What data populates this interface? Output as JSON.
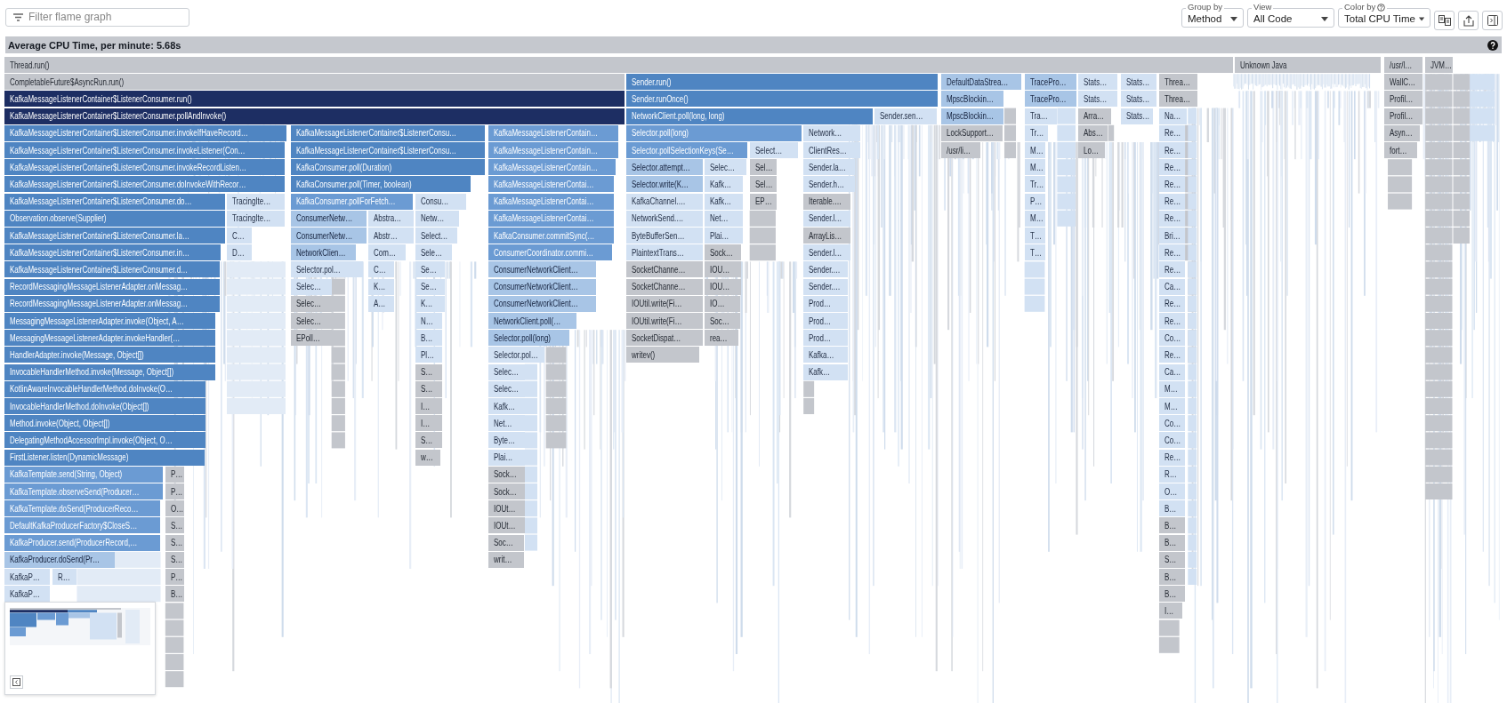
{
  "toolbar": {
    "filter": {
      "placeholder": "Filter flame graph"
    },
    "selects": [
      {
        "label": "Group by",
        "value": "Method",
        "help": false
      },
      {
        "label": "View",
        "value": "All Code",
        "help": false
      },
      {
        "label": "Color by",
        "value": "Total CPU Time",
        "help": true
      }
    ]
  },
  "summary": {
    "title": "Average CPU Time, per minute: 5.68s"
  },
  "flame_graph": {
    "levels": [
      [
        {
          "label": "Thread.run()",
          "kind": "gray"
        },
        {
          "label": "Unknown Java",
          "kind": "gray"
        },
        {
          "label": "/usr/l…",
          "kind": "gray"
        },
        {
          "label": "JVM…",
          "kind": "gray"
        }
      ],
      [
        {
          "label": "CompletableFuture$AsyncRun.run()",
          "kind": "gray"
        },
        {
          "label": "Sender.run()",
          "kind": "mid"
        },
        {
          "label": "DefaultDataStrea…",
          "kind": "light"
        },
        {
          "label": "TracePro…",
          "kind": "light"
        },
        {
          "label": "Stats…",
          "kind": "faint"
        },
        {
          "label": "Stats…",
          "kind": "faint"
        },
        {
          "label": "Threa…",
          "kind": "gray"
        },
        {
          "label": "WallC…",
          "kind": "gray"
        }
      ],
      [
        {
          "label": "KafkaMessageListenerContainer$ListenerConsumer.run()",
          "kind": "dark"
        },
        {
          "label": "Sender.runOnce()",
          "kind": "mid"
        },
        {
          "label": "MpscBlockin…",
          "kind": "light"
        },
        {
          "label": "TracePro…",
          "kind": "light"
        },
        {
          "label": "Stats…",
          "kind": "faint"
        },
        {
          "label": "Stats…",
          "kind": "faint"
        },
        {
          "label": "Threa…",
          "kind": "gray"
        },
        {
          "label": "Profil…",
          "kind": "gray"
        }
      ],
      [
        {
          "label": "KafkaMessageListenerContainer$ListenerConsumer.pollAndInvoke()",
          "kind": "dark"
        },
        {
          "label": "NetworkClient.poll(long, long)",
          "kind": "mid"
        },
        {
          "label": "Sender.sen…",
          "kind": "faint"
        },
        {
          "label": "MpscBlockin…",
          "kind": "light"
        },
        {
          "label": "Tra…",
          "kind": "faint"
        },
        {
          "label": "Arra…",
          "kind": "gray"
        },
        {
          "label": "Stats…",
          "kind": "faint"
        },
        {
          "label": "Na…",
          "kind": "faint"
        },
        {
          "label": "Profil…",
          "kind": "gray"
        }
      ],
      [
        {
          "label": "KafkaMessageListenerContainer$ListenerConsumer.invokeIfHaveRecord…",
          "kind": "mid"
        },
        {
          "label": "KafkaMessageListenerContainer$ListenerConsu…",
          "kind": "mid"
        },
        {
          "label": "KafkaMessageListenerContain…",
          "kind": "soft"
        },
        {
          "label": "Selector.poll(long)",
          "kind": "soft"
        },
        {
          "label": "Network…",
          "kind": "faint"
        },
        {
          "label": "LockSupport…",
          "kind": "gray"
        },
        {
          "label": "Tr…",
          "kind": "faint"
        },
        {
          "label": "Abs…",
          "kind": "gray"
        },
        {
          "label": "Re…",
          "kind": "faint"
        },
        {
          "label": "Asyn…",
          "kind": "gray"
        }
      ],
      [
        {
          "label": "KafkaMessageListenerContainer$ListenerConsumer.invokeListener(Con…",
          "kind": "mid"
        },
        {
          "label": "KafkaMessageListenerContainer$ListenerConsu…",
          "kind": "mid"
        },
        {
          "label": "KafkaMessageListenerContain…",
          "kind": "soft"
        },
        {
          "label": "Selector.pollSelectionKeys(Se…",
          "kind": "soft"
        },
        {
          "label": "Select…",
          "kind": "faint"
        },
        {
          "label": "ClientRes…",
          "kind": "faint"
        },
        {
          "label": "/usr/li…",
          "kind": "gray"
        },
        {
          "label": "M…",
          "kind": "faint"
        },
        {
          "label": "Lo…",
          "kind": "gray"
        },
        {
          "label": "Re…",
          "kind": "faint"
        },
        {
          "label": "fort…",
          "kind": "gray"
        }
      ],
      [
        {
          "label": "KafkaMessageListenerContainer$ListenerConsumer.invokeRecordListen…",
          "kind": "mid"
        },
        {
          "label": "KafkaConsumer.poll(Duration)",
          "kind": "mid"
        },
        {
          "label": "KafkaMessageListenerContain…",
          "kind": "soft"
        },
        {
          "label": "Selector.attempt…",
          "kind": "light"
        },
        {
          "label": "Selec…",
          "kind": "faint"
        },
        {
          "label": "Sel…",
          "kind": "gray"
        },
        {
          "label": "Sender.la…",
          "kind": "faint"
        },
        {
          "label": "M…",
          "kind": "faint"
        },
        {
          "label": "Re…",
          "kind": "faint"
        }
      ],
      [
        {
          "label": "KafkaMessageListenerContainer$ListenerConsumer.doInvokeWithRecor…",
          "kind": "mid"
        },
        {
          "label": "KafkaConsumer.poll(Timer, boolean)",
          "kind": "mid"
        },
        {
          "label": "KafkaMessageListenerContai…",
          "kind": "soft"
        },
        {
          "label": "Selector.write(K…",
          "kind": "light"
        },
        {
          "label": "Kafk…",
          "kind": "faint"
        },
        {
          "label": "Sel…",
          "kind": "gray"
        },
        {
          "label": "Sender.h…",
          "kind": "faint"
        },
        {
          "label": "Tr…",
          "kind": "faint"
        },
        {
          "label": "Re…",
          "kind": "faint"
        }
      ],
      [
        {
          "label": "KafkaMessageListenerContainer$ListenerConsumer.do…",
          "kind": "mid"
        },
        {
          "label": "TracingIte…",
          "kind": "faint"
        },
        {
          "label": "KafkaConsumer.pollForFetch…",
          "kind": "soft"
        },
        {
          "label": "Consu…",
          "kind": "faint"
        },
        {
          "label": "KafkaMessageListenerContai…",
          "kind": "soft"
        },
        {
          "label": "KafkaChannel.…",
          "kind": "faint"
        },
        {
          "label": "Kafk…",
          "kind": "faint"
        },
        {
          "label": "EP…",
          "kind": "gray"
        },
        {
          "label": "Iterable.…",
          "kind": "gray"
        },
        {
          "label": "P…",
          "kind": "faint"
        },
        {
          "label": "Re…",
          "kind": "faint"
        }
      ],
      [
        {
          "label": "Observation.observe(Supplier)",
          "kind": "mid"
        },
        {
          "label": "TracingIte…",
          "kind": "faint"
        },
        {
          "label": "ConsumerNetw…",
          "kind": "light"
        },
        {
          "label": "Abstra…",
          "kind": "faint"
        },
        {
          "label": "Netw…",
          "kind": "faint"
        },
        {
          "label": "KafkaMessageListenerContai…",
          "kind": "soft"
        },
        {
          "label": "NetworkSend.…",
          "kind": "faint"
        },
        {
          "label": "Net…",
          "kind": "faint"
        },
        {
          "label": "Sender.l…",
          "kind": "faint"
        },
        {
          "label": "M…",
          "kind": "faint"
        },
        {
          "label": "Re…",
          "kind": "faint"
        }
      ],
      [
        {
          "label": "KafkaMessageListenerContainer$ListenerConsumer.la…",
          "kind": "mid"
        },
        {
          "label": "C…",
          "kind": "faint"
        },
        {
          "label": "ConsumerNetw…",
          "kind": "light"
        },
        {
          "label": "Abstr…",
          "kind": "faint"
        },
        {
          "label": "Select…",
          "kind": "faint"
        },
        {
          "label": "KafkaConsumer.commitSync(…",
          "kind": "soft"
        },
        {
          "label": "ByteBufferSen…",
          "kind": "faint"
        },
        {
          "label": "Plai…",
          "kind": "faint"
        },
        {
          "label": "ArrayLis…",
          "kind": "gray"
        },
        {
          "label": "T…",
          "kind": "faint"
        },
        {
          "label": "Bri…",
          "kind": "faint"
        }
      ],
      [
        {
          "label": "KafkaMessageListenerContainer$ListenerConsumer.in…",
          "kind": "mid"
        },
        {
          "label": "D…",
          "kind": "faint"
        },
        {
          "label": "NetworkClien…",
          "kind": "light"
        },
        {
          "label": "Com…",
          "kind": "faint"
        },
        {
          "label": "Sele…",
          "kind": "faint"
        },
        {
          "label": "ConsumerCoordinator.commi…",
          "kind": "soft"
        },
        {
          "label": "PlaintextTrans…",
          "kind": "faint"
        },
        {
          "label": "Sock…",
          "kind": "gray"
        },
        {
          "label": "Sender.l…",
          "kind": "faint"
        },
        {
          "label": "T…",
          "kind": "faint"
        },
        {
          "label": "Re…",
          "kind": "faint"
        }
      ],
      [
        {
          "label": "KafkaMessageListenerContainer$ListenerConsumer.d…",
          "kind": "mid"
        },
        {
          "label": "Selector.pol…",
          "kind": "faint"
        },
        {
          "label": "C…",
          "kind": "faint"
        },
        {
          "label": "Se…",
          "kind": "faint"
        },
        {
          "label": "ConsumerNetworkClient…",
          "kind": "light"
        },
        {
          "label": "SocketChanne…",
          "kind": "gray"
        },
        {
          "label": "IOU…",
          "kind": "gray"
        },
        {
          "label": "Sender.…",
          "kind": "faint"
        },
        {
          "label": "Re…",
          "kind": "faint"
        }
      ],
      [
        {
          "label": "RecordMessagingMessageListenerAdapter.onMessag…",
          "kind": "mid"
        },
        {
          "label": "Selec…",
          "kind": "faint"
        },
        {
          "label": "K…",
          "kind": "faint"
        },
        {
          "label": "Se…",
          "kind": "faint"
        },
        {
          "label": "ConsumerNetworkClient…",
          "kind": "light"
        },
        {
          "label": "SocketChanne…",
          "kind": "gray"
        },
        {
          "label": "IOU…",
          "kind": "gray"
        },
        {
          "label": "Sender.…",
          "kind": "faint"
        },
        {
          "label": "Ca…",
          "kind": "faint"
        }
      ],
      [
        {
          "label": "RecordMessagingMessageListenerAdapter.onMessag…",
          "kind": "mid"
        },
        {
          "label": "Selec…",
          "kind": "gray"
        },
        {
          "label": "A…",
          "kind": "faint"
        },
        {
          "label": "K…",
          "kind": "faint"
        },
        {
          "label": "ConsumerNetworkClient…",
          "kind": "light"
        },
        {
          "label": "IOUtil.write(Fi…",
          "kind": "gray"
        },
        {
          "label": "IO…",
          "kind": "gray"
        },
        {
          "label": "Prod…",
          "kind": "faint"
        },
        {
          "label": "Re…",
          "kind": "faint"
        }
      ],
      [
        {
          "label": "MessagingMessageListenerAdapter.invoke(Object, A…",
          "kind": "mid"
        },
        {
          "label": "Selec…",
          "kind": "gray"
        },
        {
          "label": "N…",
          "kind": "faint"
        },
        {
          "label": "NetworkClient.poll(…",
          "kind": "light"
        },
        {
          "label": "IOUtil.write(Fi…",
          "kind": "gray"
        },
        {
          "label": "Soc…",
          "kind": "gray"
        },
        {
          "label": "Prod…",
          "kind": "faint"
        },
        {
          "label": "Re…",
          "kind": "faint"
        }
      ],
      [
        {
          "label": "MessagingMessageListenerAdapter.invokeHandler(…",
          "kind": "mid"
        },
        {
          "label": "EPoll…",
          "kind": "gray"
        },
        {
          "label": "B…",
          "kind": "faint"
        },
        {
          "label": "Selector.poll(long)",
          "kind": "light"
        },
        {
          "label": "SocketDispat…",
          "kind": "gray"
        },
        {
          "label": "rea…",
          "kind": "gray"
        },
        {
          "label": "Prod…",
          "kind": "faint"
        },
        {
          "label": "Co…",
          "kind": "faint"
        }
      ],
      [
        {
          "label": "HandlerAdapter.invoke(Message, Object[])",
          "kind": "mid"
        },
        {
          "label": "Pl…",
          "kind": "faint"
        },
        {
          "label": "Selector.pol…",
          "kind": "faint"
        },
        {
          "label": "writev()",
          "kind": "gray"
        },
        {
          "label": "Kafka…",
          "kind": "faint"
        },
        {
          "label": "Re…",
          "kind": "faint"
        }
      ],
      [
        {
          "label": "InvocableHandlerMethod.invoke(Message, Object[])",
          "kind": "mid"
        },
        {
          "label": "S…",
          "kind": "gray"
        },
        {
          "label": "Selec…",
          "kind": "faint"
        },
        {
          "label": "Kafk…",
          "kind": "faint"
        },
        {
          "label": "Ca…",
          "kind": "faint"
        }
      ],
      [
        {
          "label": "KotlinAwareInvocableHandlerMethod.doInvoke(O…",
          "kind": "mid"
        },
        {
          "label": "S…",
          "kind": "gray"
        },
        {
          "label": "Selec…",
          "kind": "faint"
        },
        {
          "label": "M…",
          "kind": "faint"
        }
      ],
      [
        {
          "label": "InvocableHandlerMethod.doInvoke(Object[])",
          "kind": "mid"
        },
        {
          "label": "I…",
          "kind": "gray"
        },
        {
          "label": "Kafk…",
          "kind": "faint"
        },
        {
          "label": "M…",
          "kind": "faint"
        }
      ],
      [
        {
          "label": "Method.invoke(Object, Object[])",
          "kind": "mid"
        },
        {
          "label": "I…",
          "kind": "gray"
        },
        {
          "label": "Net…",
          "kind": "faint"
        },
        {
          "label": "Co…",
          "kind": "faint"
        }
      ],
      [
        {
          "label": "DelegatingMethodAccessorImpl.invoke(Object, O…",
          "kind": "mid"
        },
        {
          "label": "S…",
          "kind": "gray"
        },
        {
          "label": "Byte…",
          "kind": "faint"
        },
        {
          "label": "Co…",
          "kind": "faint"
        }
      ],
      [
        {
          "label": "FirstListener.listen(DynamicMessage)",
          "kind": "mid"
        },
        {
          "label": "w…",
          "kind": "gray"
        },
        {
          "label": "Plai…",
          "kind": "faint"
        },
        {
          "label": "Re…",
          "kind": "faint"
        }
      ],
      [
        {
          "label": "KafkaTemplate.send(String, Object)",
          "kind": "soft"
        },
        {
          "label": "P…",
          "kind": "gray"
        },
        {
          "label": "Sock…",
          "kind": "gray"
        },
        {
          "label": "R…",
          "kind": "faint"
        }
      ],
      [
        {
          "label": "KafkaTemplate.observeSend(Producer…",
          "kind": "soft"
        },
        {
          "label": "P…",
          "kind": "gray"
        },
        {
          "label": "Sock…",
          "kind": "gray"
        },
        {
          "label": "O…",
          "kind": "faint"
        }
      ],
      [
        {
          "label": "KafkaTemplate.doSend(ProducerReco…",
          "kind": "soft"
        },
        {
          "label": "O…",
          "kind": "gray"
        },
        {
          "label": "IOUt…",
          "kind": "gray"
        },
        {
          "label": "B…",
          "kind": "faint"
        }
      ],
      [
        {
          "label": "DefaultKafkaProducerFactory$CloseS…",
          "kind": "soft"
        },
        {
          "label": "S…",
          "kind": "gray"
        },
        {
          "label": "IOUt…",
          "kind": "gray"
        },
        {
          "label": "B…",
          "kind": "gray"
        }
      ],
      [
        {
          "label": "KafkaProducer.send(ProducerRecord,…",
          "kind": "soft"
        },
        {
          "label": "S…",
          "kind": "gray"
        },
        {
          "label": "Soc…",
          "kind": "gray"
        },
        {
          "label": "B…",
          "kind": "gray"
        }
      ],
      [
        {
          "label": "KafkaProducer.doSend(Pr…",
          "kind": "light"
        },
        {
          "label": "S…",
          "kind": "gray"
        },
        {
          "label": "writ…",
          "kind": "gray"
        },
        {
          "label": "S…",
          "kind": "gray"
        }
      ],
      [
        {
          "label": "KafkaP…",
          "kind": "faint"
        },
        {
          "label": "R…",
          "kind": "faint"
        },
        {
          "label": "P…",
          "kind": "gray"
        },
        {
          "label": "B…",
          "kind": "gray"
        }
      ],
      [
        {
          "label": "KafkaP…",
          "kind": "faint"
        },
        {
          "label": "B…",
          "kind": "gray"
        },
        {
          "label": "B…",
          "kind": "gray"
        }
      ],
      [
        {
          "label": "I…",
          "kind": "gray"
        }
      ]
    ]
  }
}
